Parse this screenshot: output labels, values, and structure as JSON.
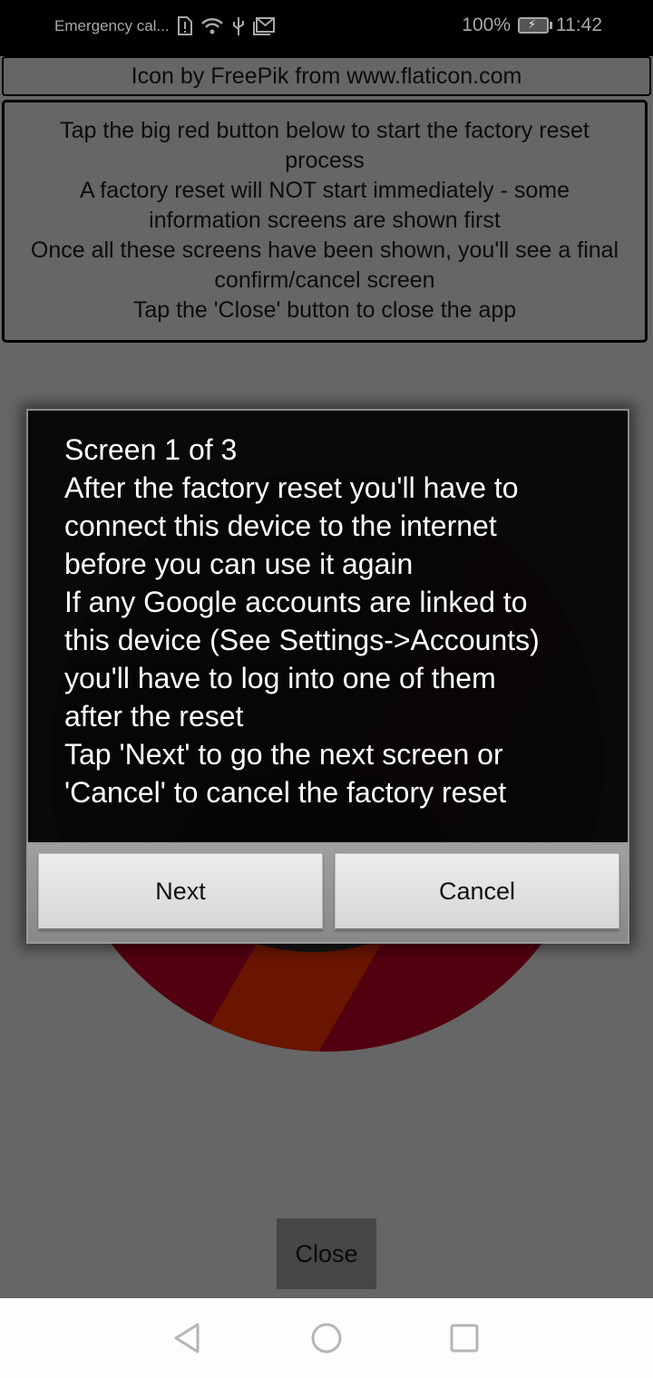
{
  "status_bar": {
    "carrier_text": "Emergency cal...",
    "icons": [
      "sim-alert-icon",
      "wifi-icon",
      "usb-icon",
      "gmail-icon"
    ],
    "battery_percent": "100%",
    "battery_icon": "battery-charging-icon",
    "time": "11:42"
  },
  "credit": {
    "text": "Icon by FreePik from www.flaticon.com"
  },
  "instructions": {
    "lines": [
      "Tap the big red button below to start the factory reset",
      "process",
      "A factory reset will NOT start immediately - some",
      "information screens are shown first",
      "Once all these screens have been shown, you'll see a final",
      "confirm/cancel screen",
      "Tap the 'Close' button to close the app"
    ]
  },
  "dialog": {
    "lines": [
      "Screen 1 of 3",
      "After the factory reset you'll have to",
      "connect this device to the internet",
      "before you can use it again",
      "If any Google accounts are linked to",
      "this device (See Settings->Accounts)",
      "you'll have to log into one of them",
      "after the reset",
      "Tap 'Next' to go the next screen or",
      "'Cancel' to cancel the factory reset"
    ],
    "next_label": "Next",
    "cancel_label": "Cancel"
  },
  "main": {
    "big_button_icon": "factory-reset-red-button-icon",
    "close_label": "Close"
  },
  "nav_bar": {
    "back_icon": "back-triangle-icon",
    "home_icon": "home-circle-icon",
    "recents_icon": "recents-square-icon"
  },
  "colors": {
    "overlay_bg": "#666666",
    "dialog_bg": "#050505",
    "button_red": "#520010",
    "button_orange": "#6a1500"
  }
}
